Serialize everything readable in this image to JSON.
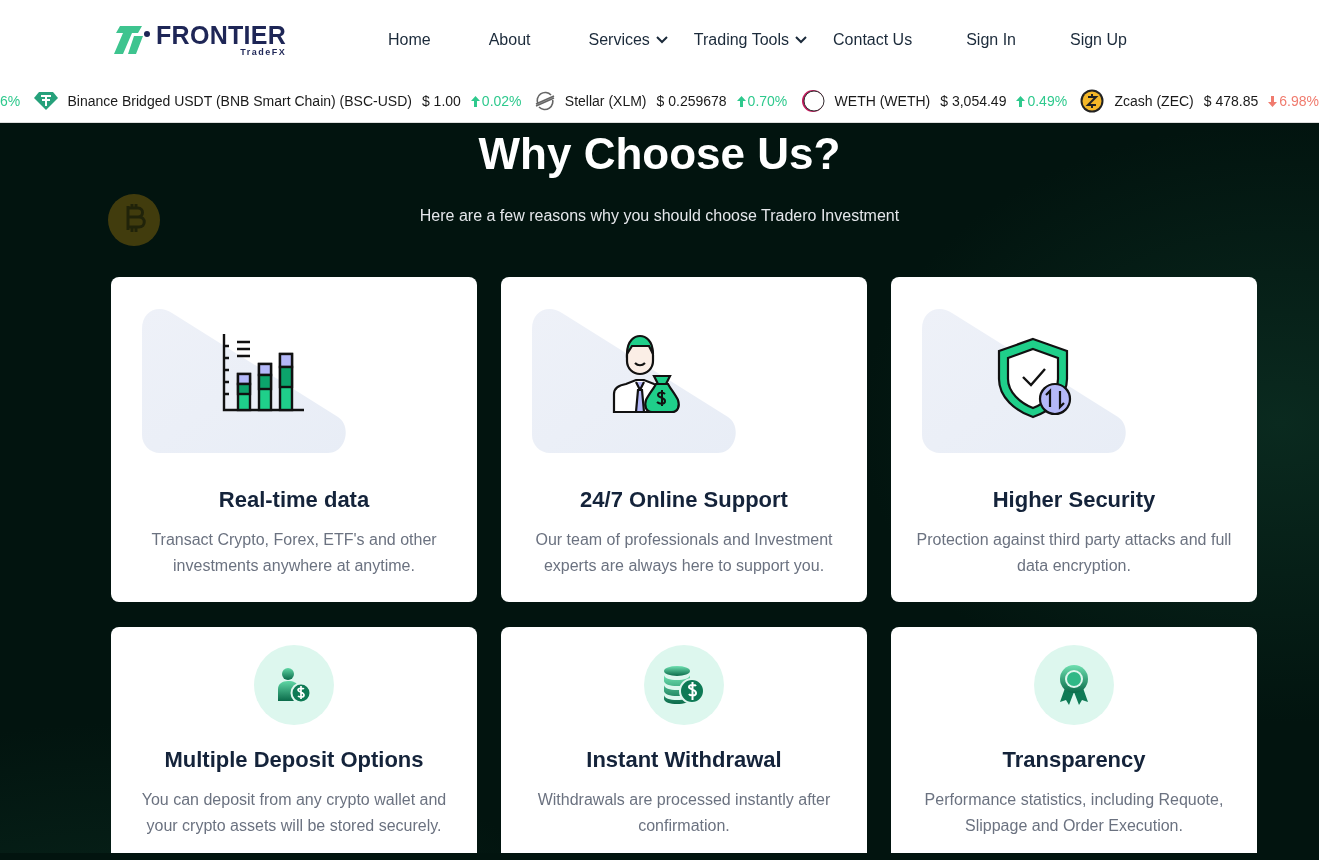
{
  "header": {
    "logo": {
      "name": "FRONTIER",
      "tagline": "TradeFX"
    },
    "nav": [
      {
        "label": "Home",
        "dropdown": false
      },
      {
        "label": "About",
        "dropdown": false
      },
      {
        "label": "Services",
        "dropdown": true
      },
      {
        "label": "Trading Tools",
        "dropdown": true
      },
      {
        "label": "Contact Us",
        "dropdown": false
      },
      {
        "label": "Sign In",
        "dropdown": false
      },
      {
        "label": "Sign Up",
        "dropdown": false
      }
    ]
  },
  "ticker": [
    {
      "kind": "partial",
      "change": "6%",
      "rising": true
    },
    {
      "kind": "tether",
      "name": "Binance Bridged USDT (BNB Smart Chain) (BSC-USD)",
      "price": "$ 1.00",
      "change": "0.02%",
      "rising": true
    },
    {
      "kind": "stellar",
      "name": "Stellar (XLM)",
      "price": "$ 0.259678",
      "change": "0.70%",
      "rising": true
    },
    {
      "kind": "weth",
      "name": "WETH (WETH)",
      "price": "$ 3,054.49",
      "change": "0.49%",
      "rising": true
    },
    {
      "kind": "zcash",
      "name": "Zcash (ZEC)",
      "price": "$ 478.85",
      "change": "6.98%",
      "rising": false
    }
  ],
  "section": {
    "title": "Why Choose Us?",
    "subtitle": "Here are a few reasons why you should choose Tradero Investment",
    "cards": [
      {
        "kind": "chart",
        "title": "Real-time data",
        "text": "Transact Crypto, Forex, ETF's and other investments anywhere at anytime."
      },
      {
        "kind": "support",
        "title": "24/7 Online Support",
        "text": "Our team of professionals and Investment experts are always here to support you."
      },
      {
        "kind": "shield",
        "title": "Higher Security",
        "text": "Protection against third party attacks and full data encryption."
      },
      {
        "kind": "deposit",
        "title": "Multiple Deposit Options",
        "text": "You can deposit from any crypto wallet and your crypto assets will be stored securely."
      },
      {
        "kind": "coins",
        "title": "Instant Withdrawal",
        "text": "Withdrawals are processed instantly after confirmation."
      },
      {
        "kind": "award",
        "title": "Transparency",
        "text": "Performance statistics, including Requote, Slippage and Order Execution."
      }
    ]
  }
}
